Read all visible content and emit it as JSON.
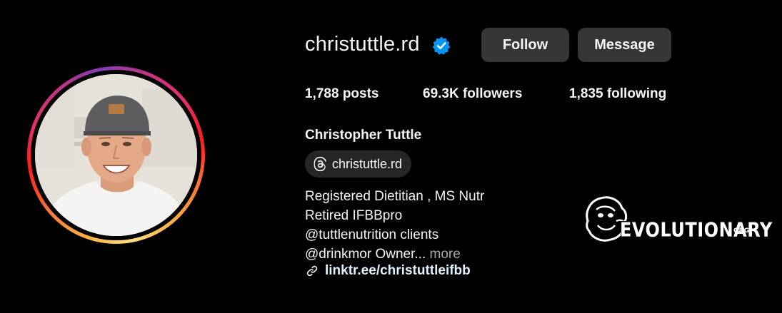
{
  "profile": {
    "username": "christuttle.rd",
    "verified": true,
    "full_name": "Christopher Tuttle",
    "threads_handle": "christuttle.rd"
  },
  "actions": {
    "follow_label": "Follow",
    "message_label": "Message"
  },
  "stats": {
    "posts": "1,788 posts",
    "followers": "69.3K followers",
    "following": "1,835 following"
  },
  "bio": {
    "lines": [
      "Registered Dietitian , MS Nutr",
      "Retired IFBBpro",
      "@tuttlenutrition clients",
      "@drinkmor Owner..."
    ],
    "more_label": "more",
    "link": "linktr.ee/christuttleifbb"
  },
  "watermark": {
    "text": "EVOLUTIONARY",
    "suffix": "ORG"
  },
  "icons": {
    "verified": "verified-badge-icon",
    "threads": "threads-icon",
    "link": "link-icon"
  },
  "colors": {
    "background": "#000000",
    "text": "#f5f5f5",
    "button": "#363636",
    "chip": "#262626",
    "verified": "#0095f6",
    "muted": "#a8a8a8",
    "link": "#e0f1ff"
  }
}
